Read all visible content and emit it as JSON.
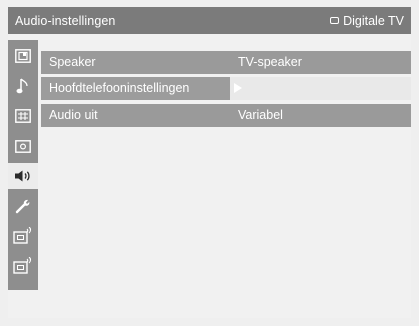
{
  "header": {
    "title": "Audio-instellingen",
    "source_icon": "tv-icon",
    "source_label": "Digitale TV"
  },
  "sidebar": {
    "items": [
      {
        "icon": "picture-icon"
      },
      {
        "icon": "music-note-icon"
      },
      {
        "icon": "grid-icon"
      },
      {
        "icon": "channel-icon"
      },
      {
        "icon": "speaker-icon",
        "active": true
      },
      {
        "icon": "wrench-icon"
      },
      {
        "icon": "antenna-a-icon"
      },
      {
        "icon": "antenna-d-icon"
      }
    ]
  },
  "menu": {
    "rows": [
      {
        "label": "Speaker",
        "value": "TV-speaker"
      },
      {
        "label": "Hoofdtelefooninstellingen",
        "value": ""
      },
      {
        "label": "Audio uit",
        "value": "Variabel"
      }
    ]
  },
  "colors": {
    "titlebar": "#7b7b7b",
    "row": "#9a9a9a",
    "background": "#efefef",
    "text": "#ffffff"
  }
}
